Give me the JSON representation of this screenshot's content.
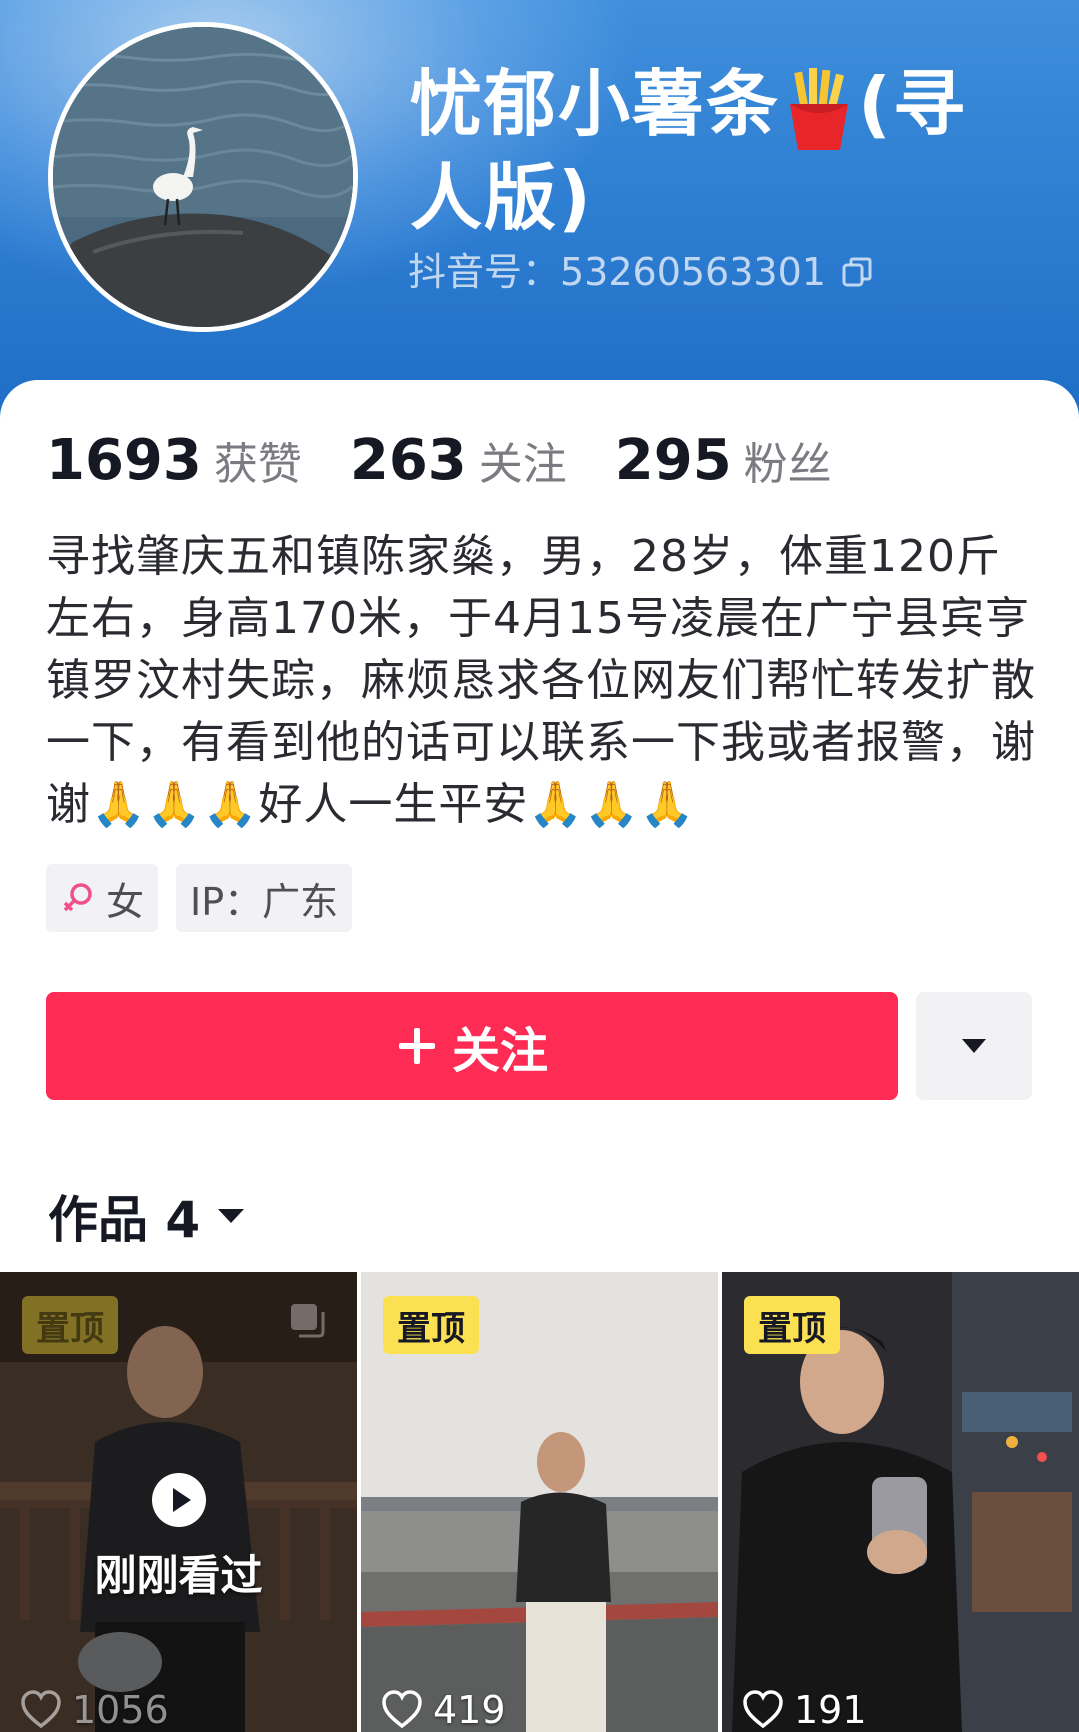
{
  "profile": {
    "nickname_part1": "忧郁小薯条",
    "nickname_emoji": "french-fries-emoji",
    "nickname_part2": "(寻人版)",
    "douyin_id": "抖音号：53260563301",
    "avatar": "egret-on-rock-photo"
  },
  "stats": [
    {
      "value": "1693",
      "label": "获赞"
    },
    {
      "value": "263",
      "label": "关注"
    },
    {
      "value": "295",
      "label": "粉丝"
    }
  ],
  "bio": "寻找肇庆五和镇陈家燊，男，28岁，体重120斤左右，身高170米，于4月15号凌晨在广宁县宾亨镇罗汶村失踪，麻烦恳求各位网友们帮忙转发扩散一下，有看到他的话可以联系一下我或者报警，谢谢🙏🙏🙏好人一生平安🙏🙏🙏",
  "tags": {
    "gender": "女",
    "ip": "IP：广东"
  },
  "actions": {
    "follow_label": "关注",
    "more": "dropdown-caret"
  },
  "works": {
    "tab_label": "作品 4",
    "items": [
      {
        "pin": "置顶",
        "recent_label": "刚刚看过",
        "likes": "1056"
      },
      {
        "pin": "置顶",
        "likes": "419"
      },
      {
        "pin": "置顶",
        "likes": "191"
      }
    ]
  },
  "colors": {
    "header_blue": "#2f7fd3",
    "follow_red": "#fe2c55",
    "pin_yellow": "#fbe152"
  }
}
